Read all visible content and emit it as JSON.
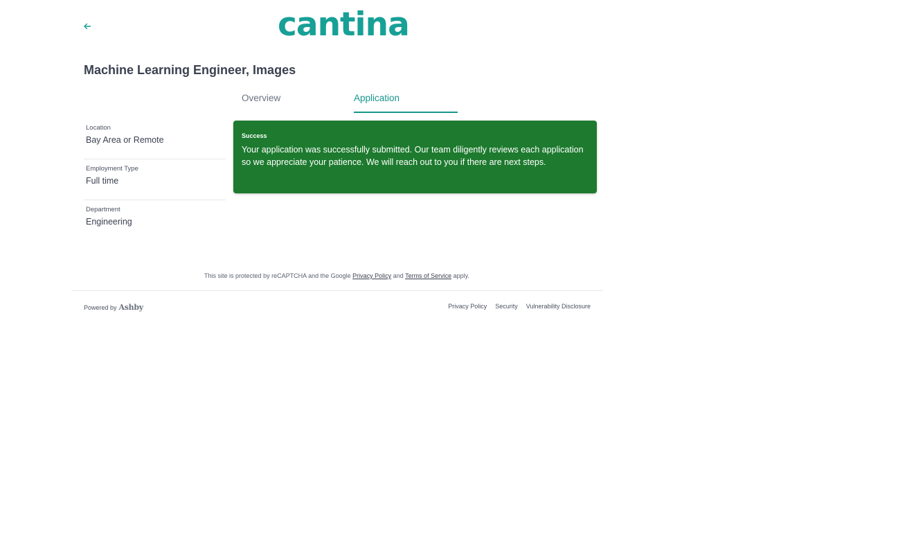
{
  "header": {
    "back_icon": "arrow-left-icon",
    "logo_text": "cantina",
    "brand_color": "#17a096"
  },
  "job": {
    "title": "Machine Learning Engineer, Images"
  },
  "tabs": [
    {
      "label": "Overview",
      "active": false
    },
    {
      "label": "Application",
      "active": true
    }
  ],
  "sidebar": {
    "items": [
      {
        "label": "Location",
        "value": "Bay Area or Remote"
      },
      {
        "label": "Employment Type",
        "value": "Full time"
      },
      {
        "label": "Department",
        "value": "Engineering"
      }
    ]
  },
  "alert": {
    "title": "Success",
    "message": "Your application was successfully submitted. Our team diligently reviews each application so we appreciate your patience. We will reach out to you if there are next steps.",
    "color": "#1d7a2e"
  },
  "recaptcha": {
    "prefix": "This site is protected by reCAPTCHA and the Google",
    "privacy_link": "Privacy Policy",
    "middle": "and",
    "terms_link": "Terms of Service",
    "suffix": "apply."
  },
  "footer": {
    "powered_by": "Powered by",
    "ashby_logo": "Ashby",
    "links": [
      "Privacy Policy",
      "Security",
      "Vulnerability Disclosure"
    ]
  }
}
